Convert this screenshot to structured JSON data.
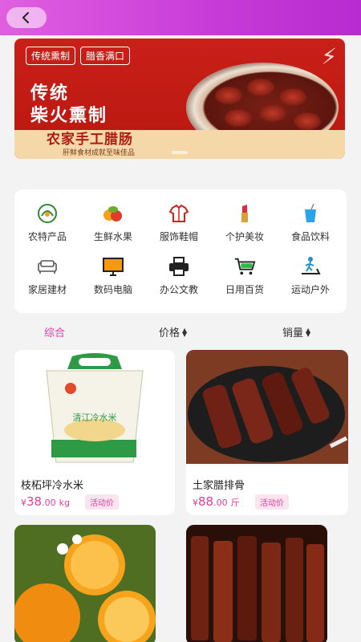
{
  "header": {
    "back_icon": "chevron-left-icon",
    "gradient": [
      "#e05fe0",
      "#b72bd0"
    ]
  },
  "banner": {
    "tags": [
      "传统熏制",
      "腊香满口"
    ],
    "headline_1": "传统",
    "headline_2": "柴火熏制",
    "subhead": "农家手工腊肠",
    "fine_print": "肝鲜食材成就至味佳品",
    "bg_color": "#c92019"
  },
  "categories": [
    {
      "label": "农特产品",
      "icon": "farm-product-icon"
    },
    {
      "label": "生鲜水果",
      "icon": "fruit-icon"
    },
    {
      "label": "服饰鞋帽",
      "icon": "clothing-icon"
    },
    {
      "label": "个护美妆",
      "icon": "lipstick-icon"
    },
    {
      "label": "食品饮料",
      "icon": "drink-cup-icon"
    },
    {
      "label": "家居建材",
      "icon": "sofa-icon"
    },
    {
      "label": "数码电脑",
      "icon": "monitor-icon"
    },
    {
      "label": "办公文教",
      "icon": "printer-icon"
    },
    {
      "label": "日用百货",
      "icon": "shopping-cart-icon"
    },
    {
      "label": "运动户外",
      "icon": "treadmill-icon"
    }
  ],
  "sort": [
    {
      "label": "综合",
      "active": true
    },
    {
      "label": "价格",
      "active": false
    },
    {
      "label": "销量",
      "active": false
    }
  ],
  "products": [
    {
      "title": "枝柘坪冷水米",
      "currency": "¥",
      "price_int": "38",
      "price_dec": ".00",
      "unit": "kg",
      "badge": "活动价",
      "bag_text": "清江冷水米"
    },
    {
      "title": "土家腊排骨",
      "currency": "¥",
      "price_int": "88",
      "price_dec": ".00",
      "unit": "斤",
      "badge": "活动价"
    },
    {
      "title": "",
      "currency": "",
      "price_int": "",
      "price_dec": "",
      "unit": "",
      "badge": ""
    },
    {
      "title": "",
      "currency": "",
      "price_int": "",
      "price_dec": "",
      "unit": "",
      "badge": ""
    }
  ],
  "accent_color": "#d63dac"
}
